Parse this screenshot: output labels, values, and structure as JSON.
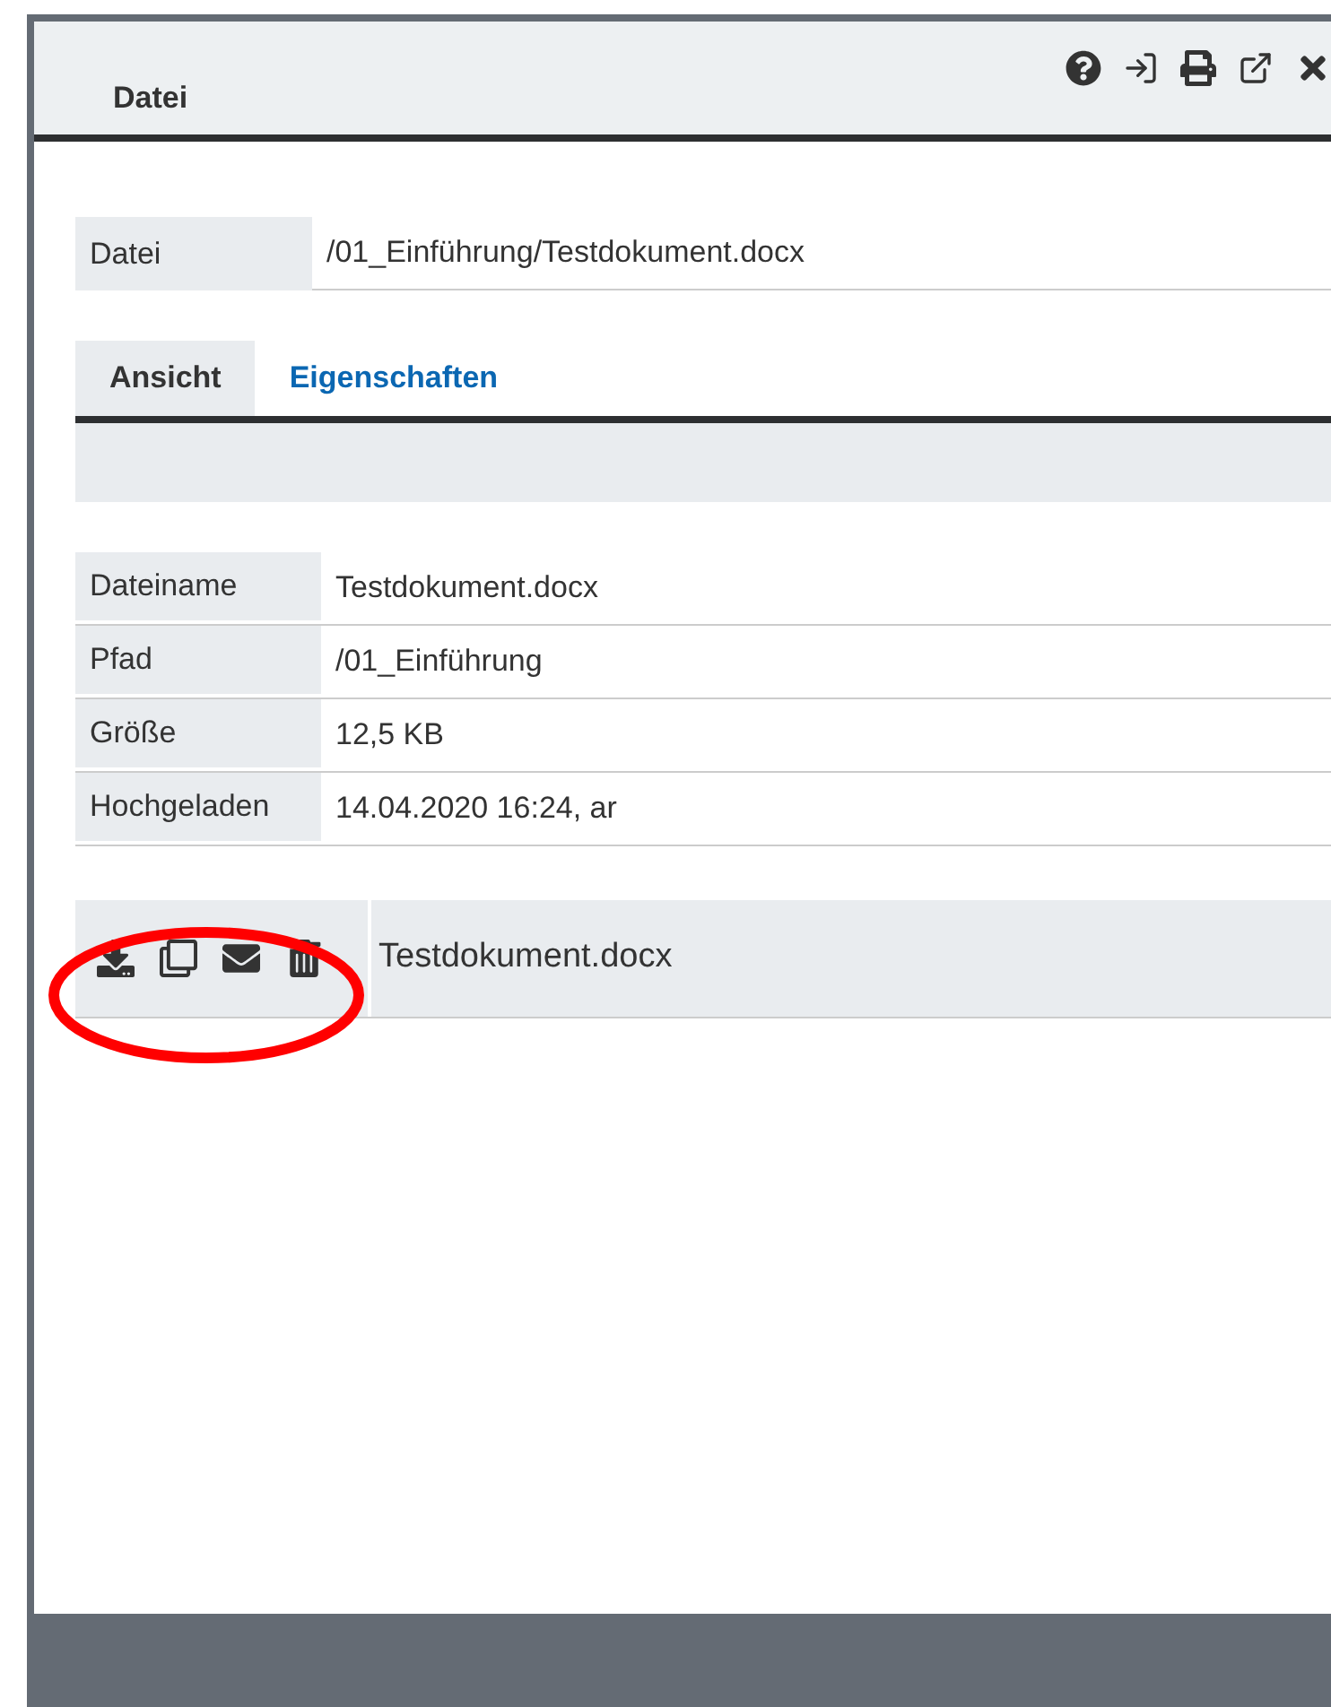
{
  "dialog": {
    "title": "Datei"
  },
  "file_field": {
    "label": "Datei",
    "value": "/01_Einführung/Testdokument.docx"
  },
  "tabs": [
    {
      "label": "Ansicht",
      "selected": true
    },
    {
      "label": "Eigenschaften",
      "selected": false
    }
  ],
  "properties": [
    {
      "label": "Dateiname",
      "value": "Testdokument.docx"
    },
    {
      "label": "Pfad",
      "value": "/01_Einführung"
    },
    {
      "label": "Größe",
      "value": "12,5 KB"
    },
    {
      "label": "Hochgeladen",
      "value": "14.04.2020 16:24, ar"
    }
  ],
  "file_row": {
    "name": "Testdokument.docx"
  }
}
